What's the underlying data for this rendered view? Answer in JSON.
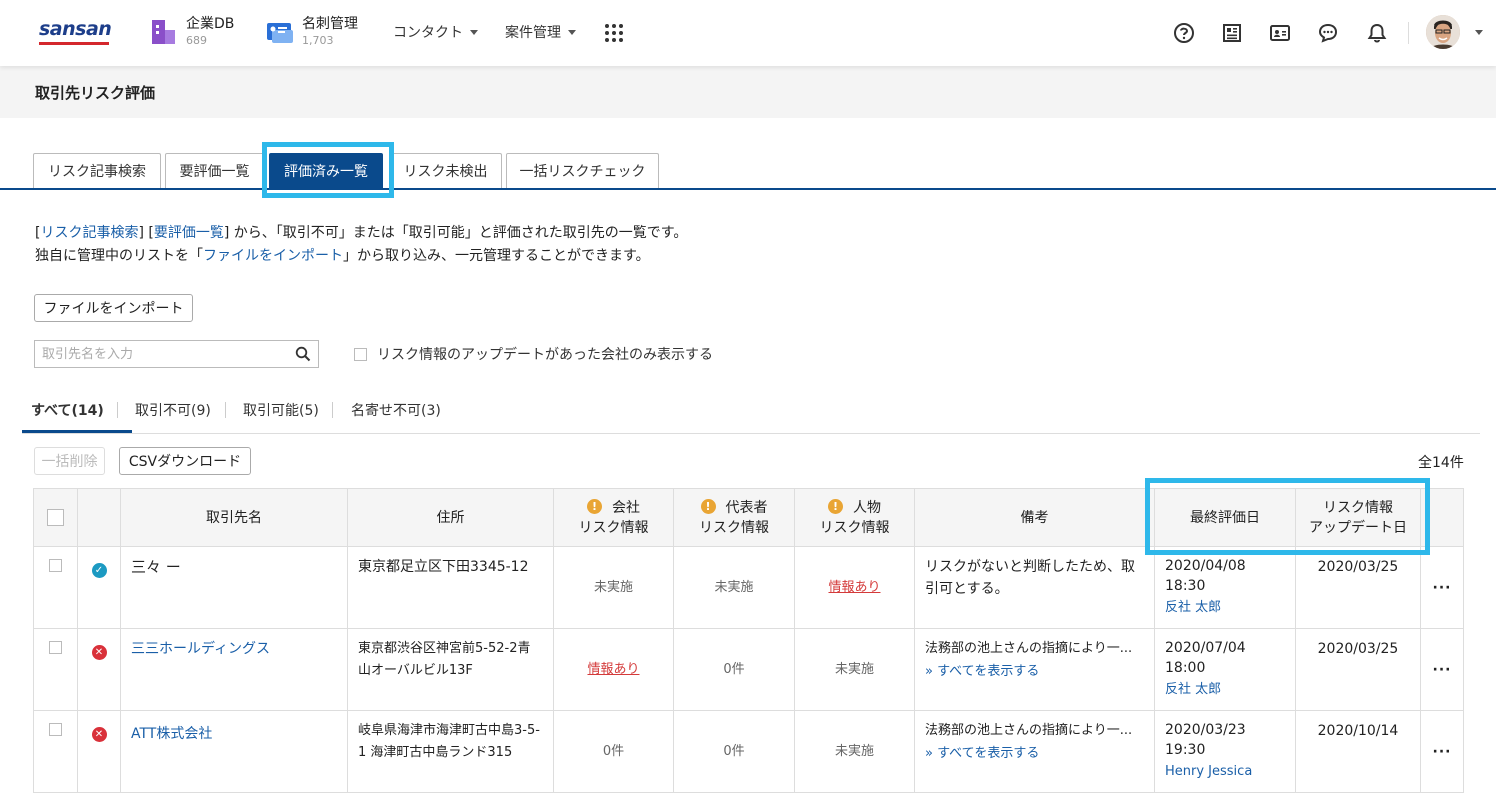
{
  "header": {
    "logo": "sansan",
    "apps": [
      {
        "name": "企業DB",
        "count": "689"
      },
      {
        "name": "名刺管理",
        "count": "1,703"
      }
    ],
    "menus": [
      "コンタクト",
      "案件管理"
    ]
  },
  "page": {
    "title": "取引先リスク評価"
  },
  "tabs": [
    "リスク記事検索",
    "要評価一覧",
    "評価済み一覧",
    "リスク未検出",
    "一括リスクチェック"
  ],
  "description": {
    "link1": "リスク記事検索",
    "link2": "要評価一覧",
    "line1_rest": "から、「取引不可」または「取引可能」と評価された取引先の一覧です。",
    "line2_prefix": "独自に管理中のリストを「",
    "line2_link": "ファイルをインポート",
    "line2_rest": "」から取り込み、一元管理することができます。"
  },
  "import_button": "ファイルをインポート",
  "search": {
    "placeholder": "取引先名を入力"
  },
  "filter_checkbox": "リスク情報のアップデートがあった会社のみ表示する",
  "subtabs": [
    "すべて(14)",
    "取引不可(9)",
    "取引可能(5)",
    "名寄せ不可(3)"
  ],
  "bulk_delete": "一括削除",
  "csv_download": "CSVダウンロード",
  "total": "全14件",
  "table": {
    "headers": {
      "name": "取引先名",
      "address": "住所",
      "company_risk_1": "会社",
      "company_risk_2": "リスク情報",
      "rep_risk_1": "代表者",
      "rep_risk_2": "リスク情報",
      "person_risk_1": "人物",
      "person_risk_2": "リスク情報",
      "note": "備考",
      "last_eval": "最終評価日",
      "risk_update_1": "リスク情報",
      "risk_update_2": "アップデート日"
    },
    "rows": [
      {
        "status": "ok",
        "name": "三々 ー",
        "address": "東京都足立区下田3345-12",
        "company_risk": "未実施",
        "rep_risk": "未実施",
        "person_risk": "情報あり",
        "note": "リスクがないと判断したため、取引可とする。",
        "show_all": "",
        "eval_date": "2020/04/08 18:30",
        "evaluator": "反社 太郎",
        "update_date": "2020/03/25"
      },
      {
        "status": "ng",
        "name": "三三ホールディングス",
        "address": "東京都渋谷区神宮前5-52-2青山オーバルビル13F",
        "company_risk": "情報あり",
        "rep_risk": "0件",
        "person_risk": "未実施",
        "note": "法務部の池上さんの指摘により一...",
        "show_all": "» すべてを表示する",
        "eval_date": "2020/07/04 18:00",
        "evaluator": "反社 太郎",
        "update_date": "2020/03/25"
      },
      {
        "status": "ng",
        "name": "ATT株式会社",
        "address": "岐阜県海津市海津町古中島3-5-1 海津町古中島ランド315",
        "company_risk": "0件",
        "rep_risk": "0件",
        "person_risk": "未実施",
        "note": "法務部の池上さんの指摘により一...",
        "show_all": "» すべてを表示する",
        "eval_date": "2020/03/23 19:30",
        "evaluator": "Henry Jessica",
        "update_date": "2020/10/14"
      }
    ]
  },
  "colors": {
    "brand_blue": "#0a4a8c",
    "highlight": "#2eb8ea",
    "danger": "#d9313a",
    "ok": "#1c9ac2",
    "warn": "#e9a534"
  }
}
